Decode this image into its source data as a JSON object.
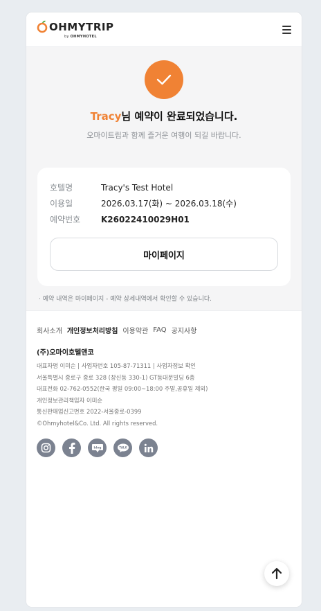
{
  "header": {
    "logo_text": "OHMYTRIP",
    "logo_by": "by",
    "logo_brand": "OHMYHOTEL",
    "menu_icon": "hamburger-icon"
  },
  "confirmation": {
    "icon": "check-icon",
    "accent_color": "#f08234",
    "guest_name": "Tracy",
    "title_suffix": "님 예약이 완료되었습니다.",
    "subtitle": "오마이트립과 함께 즐거운 여행이 되길 바랍니다."
  },
  "booking": {
    "rows": [
      {
        "label": "호텔명",
        "value": "Tracy's Test Hotel"
      },
      {
        "label": "이용일",
        "value": "2026.03.17(화) ~ 2026.03.18(수)"
      },
      {
        "label": "예약번호",
        "value": "K26022410029H01"
      }
    ],
    "mypage_button": "마이페이지"
  },
  "note": "· 예약 내역은 마이페이지 - 예약 상세내역에서 확인할 수 있습니다.",
  "footer": {
    "links": [
      "회사소개",
      "개인정보처리방침",
      "이용약관",
      "FAQ",
      "공지사항"
    ],
    "company": "(주)오마이호텔앤코",
    "info_lines": [
      "대표자명 이미순 | 사업자번호 105-87-71311 | 사업자정보 확인",
      "서울특별시 종로구 종로 328 (창신동 330-1) GT동대문빌딩 6층",
      "대표전화 02-762-0552(한국 평일 09:00~18:00 주말,공휴일 제외)",
      "개인정보관리책임자 이미순",
      "통신판매업신고번호 2022-서울종로-0399",
      "©Ohmyhotel&Co. Ltd. All rights reserved."
    ],
    "sns": [
      "instagram-icon",
      "facebook-icon",
      "blog-icon",
      "kakaotalk-icon",
      "linkedin-icon"
    ],
    "sns_labels": {
      "blog": "blog",
      "talk": "TALK"
    }
  },
  "scroll_top_icon": "arrow-up-icon"
}
